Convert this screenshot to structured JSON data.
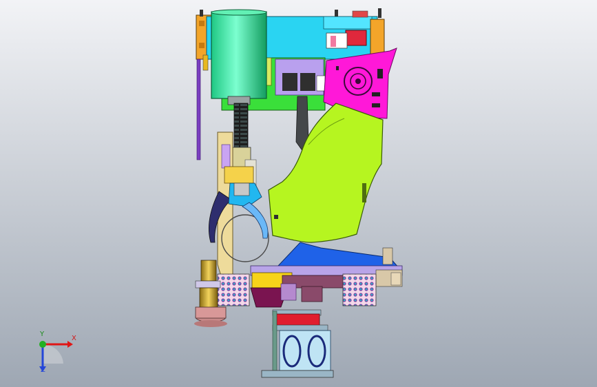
{
  "viewport": {
    "background_top": "#f2f3f6",
    "background_bottom": "#9ea7b3"
  },
  "triad": {
    "x_label": "X",
    "y_label": "Y",
    "z_label": "Z",
    "x_color": "#e01616",
    "y_color": "#22b022",
    "z_color": "#2446d8"
  },
  "icons": {
    "triad": "axis-triad-icon"
  }
}
